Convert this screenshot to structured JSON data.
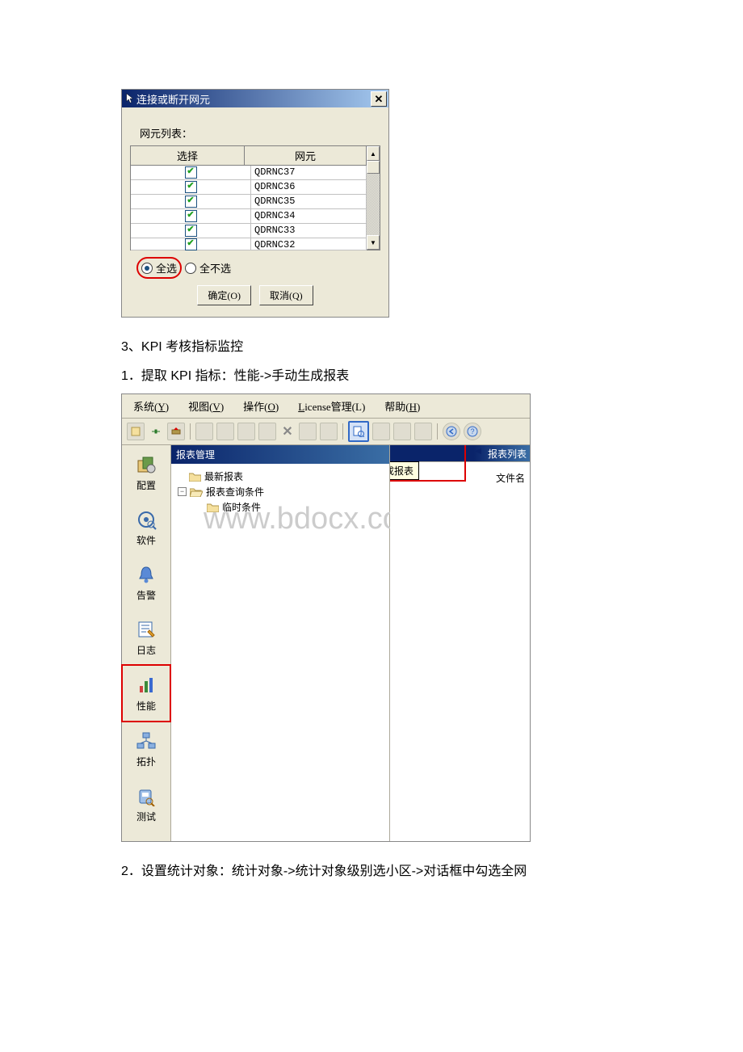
{
  "dialog": {
    "title": "连接或断开网元",
    "list_label": "网元列表：",
    "col_select": "选择",
    "col_ne": "网元",
    "rows": [
      {
        "checked": true,
        "name": "QDRNC37"
      },
      {
        "checked": true,
        "name": "QDRNC36"
      },
      {
        "checked": true,
        "name": "QDRNC35"
      },
      {
        "checked": true,
        "name": "QDRNC34"
      },
      {
        "checked": true,
        "name": "QDRNC33"
      },
      {
        "checked": true,
        "name": "QDRNC32"
      }
    ],
    "select_all": "全选",
    "select_none": "全不选",
    "ok": "确定(O)",
    "cancel": "取消(Q)"
  },
  "text": {
    "p1": "3、KPI 考核指标监控",
    "p2": "1．提取 KPI 指标：性能->手动生成报表",
    "p3": "2．设置统计对象：统计对象->统计对象级别选小区->对话框中勾选全网"
  },
  "menu": {
    "system": "系统(Y)",
    "view": "视图(V)",
    "operate": "操作(O)",
    "license": "License管理(L)",
    "help": "帮助(H)"
  },
  "tree": {
    "header": "报表管理",
    "node1": "最新报表",
    "node2": "报表查询条件",
    "node3": "临时条件"
  },
  "sidebar": {
    "config": "配置",
    "software": "软件",
    "alarm": "告警",
    "log": "日志",
    "perf": "性能",
    "topo": "拓扑",
    "test": "测试"
  },
  "right": {
    "title": "报表列表",
    "tooltip": "手动生成报表",
    "filename_col": "文件名"
  },
  "watermark": "www.bdocx.com"
}
